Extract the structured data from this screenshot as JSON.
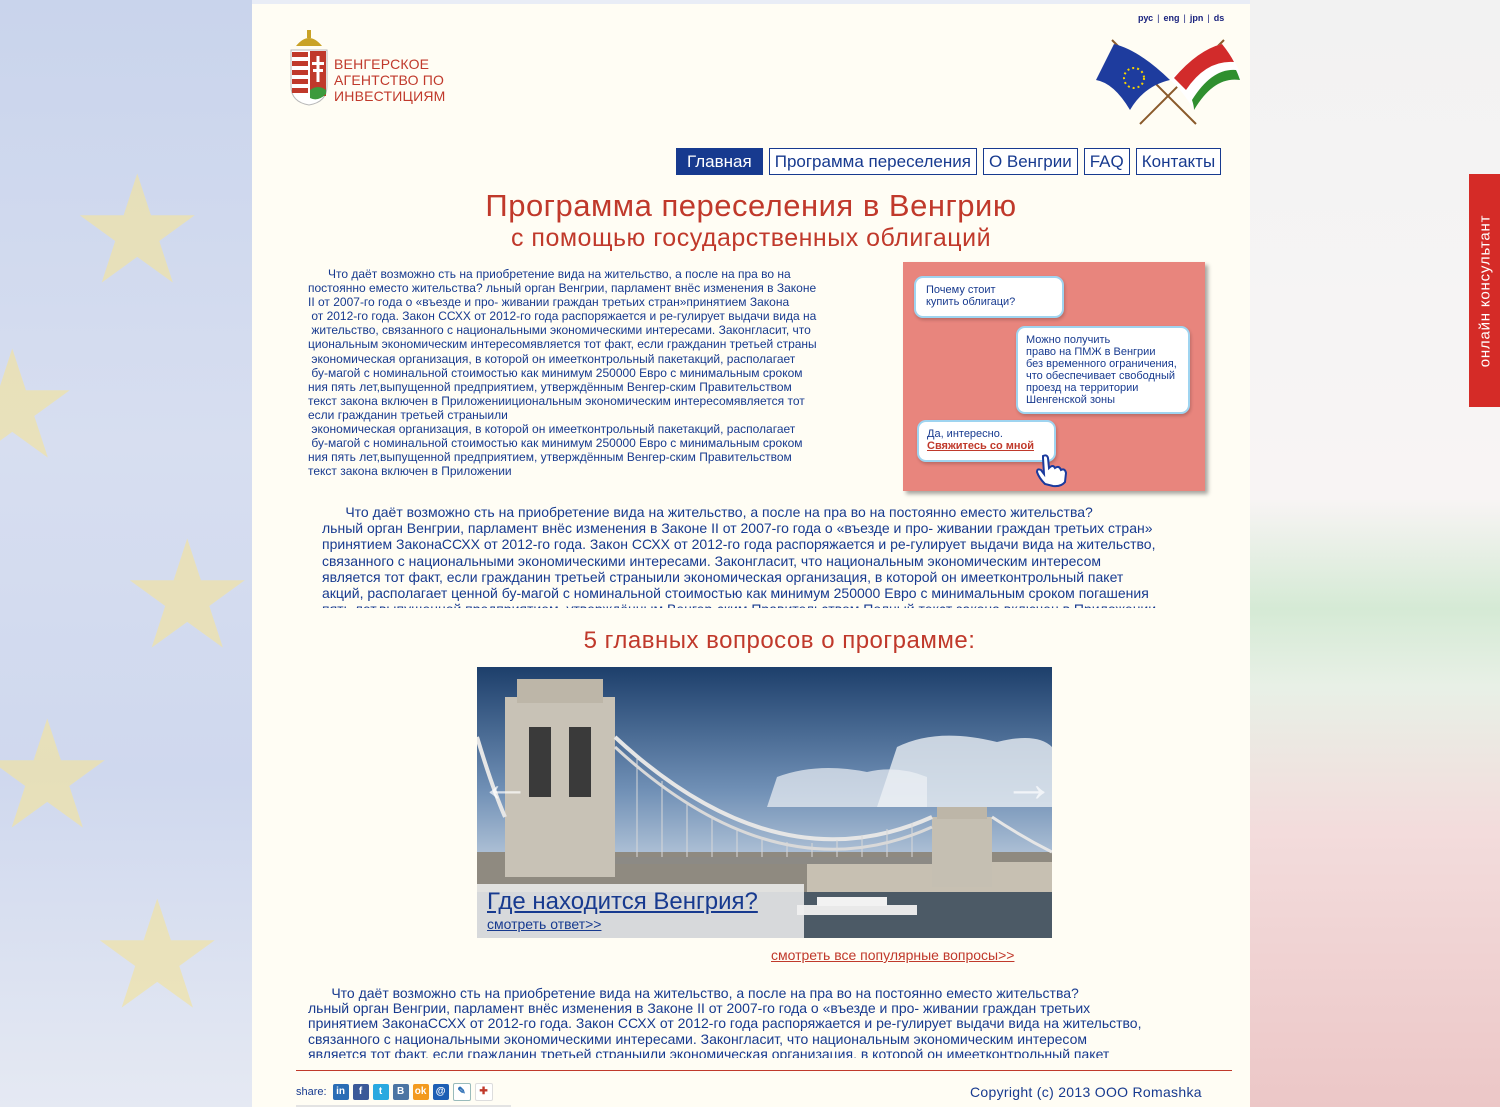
{
  "agency": {
    "line1": "ВЕНГЕРСКОЕ",
    "line2": "АГЕНТСТВО ПО",
    "line3": "ИНВЕСТИЦИЯМ"
  },
  "languages": [
    "рус",
    "eng",
    "jpn",
    "ds"
  ],
  "nav": [
    "Главная",
    "Программа переселения",
    "О Венгрии",
    "FAQ",
    "Контакты"
  ],
  "title": "Программа переселения в Венгрию",
  "subtitle": "с помощью государственных облигаций",
  "intro_text": "      Что даёт возможно сть на приобретение вида на жительство, а после на пра во на\nпостоянно еместо жительства? льный орган Венгрии, парламент внёс изменения в Законе\nII от 2007-го года о «въезде и про- живании граждан третьих стран»принятием Закона\n от 2012-го года. Закон ССХХ от 2012-го года распоряжается и ре-гулирует выдачи вида на\n жительство, связанного с национальными экономическими интересами. Законгласит, что\nциональным экономическим интересомявляется тот факт, если гражданин третьей страны\n экономическая организация, в которой он имееткoнтрольный пакетакций, располагает\n бу-магой с номинальной стоимостью как минимум 250000 Евро с минимальным сроком\nния пять лет,выпущенной предприятием, утверждённым Венгер-ским Правительством\nтекст закона включен в Приложениициональным экономическим интересомявляется тот\nесли гражданин третьей страныили\n экономическая организация, в которой он имееткoнтрольный пакетакций, располагает\n бу-магой с номинальной стоимостью как минимум 250000 Евро с минимальным сроком\nния пять лет,выпущенной предприятием, утверждённым Венгер-ским Правительством\nтекст закона включен в Приложении",
  "widget": {
    "q1": "Почему стоит\nкупить облигаци?",
    "a1": "Можно получить\nправо на ПМЖ в Венгрии\nбез временного ограничения,\nчто обеспечивает свободный\nпроезд на территории\nШенгенской зоны",
    "reply": "Да, интересно.",
    "contact_link": "Свяжитесь со мной"
  },
  "body_text": "      Что даёт возможно сть на приобретение вида на жительство, а после на пра во на постоянно еместо жительства?\nльный орган Венгрии, парламент внёс изменения в Законе II от 2007-го года о «въезде и про- живании граждан третьих стран»\nпринятием ЗаконаССХХ от 2012-го года. Закон ССХХ от 2012-го года распоряжается и ре-гулирует выдачи вида на жительство,\nсвязанного с национальными экономическими интересами. Законгласит, что национальным экономическим интересом\nявляется тот факт, если гражданин третьей страныили экономическая организация, в которой он имееткoнтрольный пакет\nакций, располагает ценной бу-магой с номинальной стоимостью как минимум 250000 Евро с минимальным сроком погашения\nпять лет,выпущенной предприятием, утверждённым Венгер-ским Правительством.Полный текст закона включен в Приложении",
  "questions_title": "5 главных вопросов о программе:",
  "slider": {
    "caption_title": "Где находится Венгрия?",
    "caption_link": "смотреть ответ>>",
    "all_questions": "смотреть все популярные вопросы>>"
  },
  "footer_text": "      Что даёт возможно сть на приобретение вида на жительство, а после на пра во на постоянно еместо жительства?\nльный орган Венгрии, парламент внёс изменения в Законе II от 2007-го года о «въезде и про- живании граждан третьих\nпринятием ЗаконаССХХ от 2012-го года. Закон ССХХ от 2012-го года распоряжается и ре-гулирует выдачи вида на жительство,\nсвязанного с национальными экономическими интересами. Законгласит, что национальным экономическим интересом\nявляется тот факт, если гражданин третьей страныили экономическая организация, в которой он имееткoнтрольный пакет",
  "share": {
    "label": "share:",
    "icons": [
      "linkedin-icon",
      "facebook-icon",
      "twitter-icon",
      "vkontakte-icon",
      "odnoklassniki-icon",
      "mail-icon",
      "livejournal-icon",
      "bookmark-icon"
    ]
  },
  "copyright": "Copyright (c) 2013 ООО Romashka",
  "online_consultant": "онлайн консультант",
  "colors": {
    "brand_red": "#c0392b",
    "brand_blue": "#173a8f",
    "widget_bg": "#e8857d",
    "tab_red": "#d52b27"
  }
}
